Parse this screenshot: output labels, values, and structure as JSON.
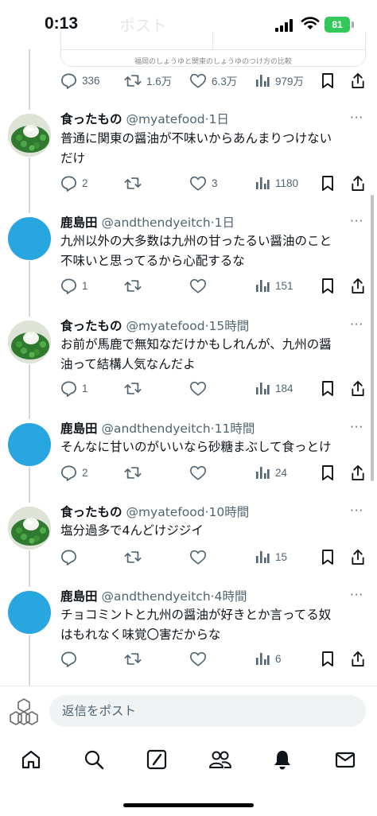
{
  "status": {
    "time": "0:13",
    "battery": "81",
    "ghost_title": "ポスト"
  },
  "card": {
    "caption": "福岡のしょうゆと関東のしょうゆのつけ方の比較"
  },
  "top_stats": {
    "replies": "336",
    "reposts": "1.6万",
    "likes": "6.3万",
    "views": "979万"
  },
  "tweets": [
    {
      "name": "食ったもの",
      "handle": "@myatefood",
      "dot": "·",
      "time": "1日",
      "avatar": "food",
      "lines": [
        "普通に関東の醤油が不味いからあんまりつけない",
        "だけ"
      ],
      "replies": "2",
      "reposts": "",
      "likes": "3",
      "views": "1180"
    },
    {
      "name": "鹿島田",
      "handle": "@andthendyeitch",
      "dot": "·",
      "time": "1日",
      "avatar": "blue",
      "lines": [
        "九州以外の大多数は九州の甘ったるい醤油のこと",
        "不味いと思ってるから心配するな"
      ],
      "replies": "1",
      "reposts": "",
      "likes": "",
      "views": "151"
    },
    {
      "name": "食ったもの",
      "handle": "@myatefood",
      "dot": "·",
      "time": "15時間",
      "avatar": "food",
      "lines": [
        "お前が馬鹿で無知なだけかもしれんが、九州の醤",
        "油って結構人気なんだよ"
      ],
      "replies": "1",
      "reposts": "",
      "likes": "",
      "views": "184"
    },
    {
      "name": "鹿島田",
      "handle": "@andthendyeitch",
      "dot": "·",
      "time": "11時間",
      "avatar": "blue",
      "lines": [
        "そんなに甘いのがいいなら砂糖まぶして食っとけ"
      ],
      "replies": "2",
      "reposts": "",
      "likes": "",
      "views": "24"
    },
    {
      "name": "食ったもの",
      "handle": "@myatefood",
      "dot": "·",
      "time": "10時間",
      "avatar": "food",
      "lines": [
        "塩分過多で4んどけジジイ"
      ],
      "replies": "",
      "reposts": "",
      "likes": "",
      "views": "15"
    },
    {
      "name": "鹿島田",
      "handle": "@andthendyeitch",
      "dot": "·",
      "time": "4時間",
      "avatar": "blue",
      "lines": [
        "チョコミントと九州の醤油が好きとか言ってる奴",
        "はもれなく味覚〇害だからな"
      ],
      "replies": "",
      "reposts": "",
      "likes": "",
      "views": "6"
    }
  ],
  "reply_bar": {
    "placeholder": "返信をポスト"
  },
  "tabs": [
    {
      "name": "home",
      "icon": "home-icon"
    },
    {
      "name": "search",
      "icon": "search-icon"
    },
    {
      "name": "grok",
      "icon": "grok-icon"
    },
    {
      "name": "communities",
      "icon": "people-icon"
    },
    {
      "name": "notifications",
      "icon": "bell-icon"
    },
    {
      "name": "messages",
      "icon": "mail-icon"
    }
  ],
  "colors": {
    "text": "#0f1419",
    "secondary": "#536471",
    "avatar_blue": "#27a6e0",
    "battery": "#34c759"
  }
}
